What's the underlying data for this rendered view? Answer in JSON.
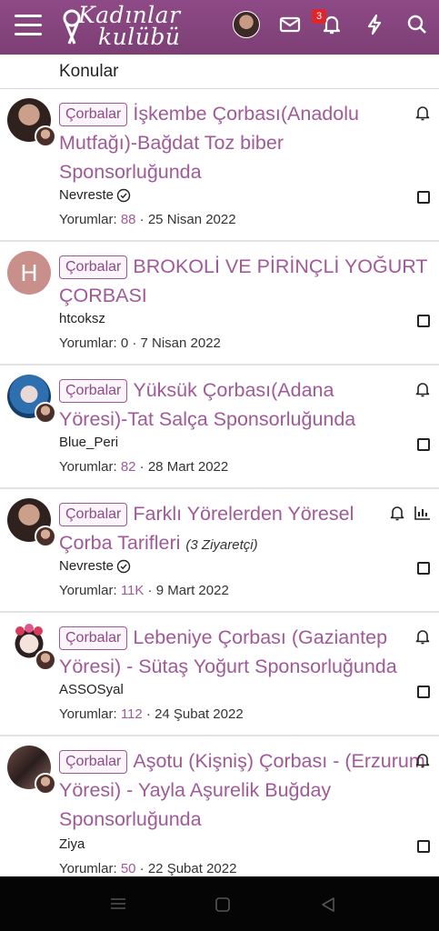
{
  "app": {
    "logo_line1": "Kadınlar",
    "logo_line2": "kulübü",
    "notification_count": "3",
    "brand_color": "#8e4a86",
    "link_color": "#a05a98"
  },
  "header_icons": [
    "menu-icon",
    "avatar",
    "mail-icon",
    "bell-icon",
    "lightning-icon",
    "search-icon"
  ],
  "section": {
    "title": "Konular"
  },
  "topics": [
    {
      "prefix": "Çorbalar",
      "title": "İşkembe Çorbası(Anadolu Mutfağı)-Bağdat Toz biber Sponsorluğunda",
      "author": "Nevreste",
      "verified": true,
      "comments_label": "Yorumlar:",
      "comments": "88",
      "date": "25 Nisan 2022",
      "bell": true
    },
    {
      "prefix": "Çorbalar",
      "title": "BROKOLİ VE PİRİNÇLİ YOĞURT ÇORBASI",
      "author": "htcoksz",
      "avatar_letter": "H",
      "comments_label": "Yorumlar:",
      "comments": "0",
      "date": "7 Nisan 2022",
      "bell": false
    },
    {
      "prefix": "Çorbalar",
      "title": "Yüksük Çorbası(Adana Yöresi)-Tat Salça Sponsorluğunda",
      "author": "Blue_Peri",
      "comments_label": "Yorumlar:",
      "comments": "82",
      "date": "28 Mart 2022",
      "bell": true
    },
    {
      "prefix": "Çorbalar",
      "title": "Farklı Yörelerden Yöresel Çorba Tarifleri",
      "visitors": "(3 Ziyaretçi)",
      "author": "Nevreste",
      "verified": true,
      "comments_label": "Yorumlar:",
      "comments": "11K",
      "date": "9 Mart 2022",
      "bell": true,
      "stats": true
    },
    {
      "prefix": "Çorbalar",
      "title": "Lebeniye Çorbası (Gaziantep Yöresi) - Sütaş Yoğurt Sponsorluğunda",
      "author": "ASSOSyal",
      "comments_label": "Yorumlar:",
      "comments": "112",
      "date": "24 Şubat 2022",
      "bell": true
    },
    {
      "prefix": "Çorbalar",
      "title": "Aşotu (Kişniş) Çorbası - (Erzurum Yöresi) - Yayla Aşurelik Buğday Sponsorluğunda",
      "author": "Ziya",
      "comments_label": "Yorumlar:",
      "comments": "50",
      "date": "22 Şubat 2022",
      "bell": true
    }
  ],
  "system_nav": [
    "recent-apps-icon",
    "home-icon",
    "back-icon"
  ]
}
